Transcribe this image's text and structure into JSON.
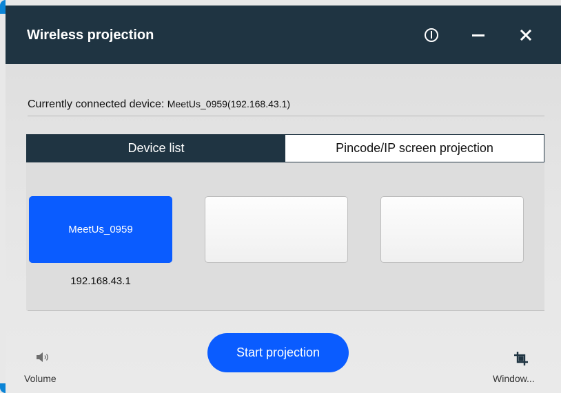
{
  "window": {
    "title": "Wireless projection",
    "accent_color": "#0a5cff",
    "titlebar_color": "#1f3442"
  },
  "titlebar_buttons": {
    "info_icon": "info-circle-icon",
    "minimize_icon": "minimize-icon",
    "close_icon": "close-icon"
  },
  "connection": {
    "label": "Currently connected device: ",
    "device": "MeetUs_0959(192.168.43.1)"
  },
  "tabs": [
    {
      "label": "Device list",
      "selected": true
    },
    {
      "label": "Pincode/IP screen projection",
      "selected": false
    }
  ],
  "devices": [
    {
      "name": "MeetUs_0959",
      "ip": "192.168.43.1",
      "selected": true
    },
    {
      "name": "",
      "ip": "",
      "selected": false
    },
    {
      "name": "",
      "ip": "",
      "selected": false
    }
  ],
  "actions": {
    "start_label": "Start projection",
    "volume_label": "Volume",
    "volume_icon": "speaker-icon",
    "window_label": "Window...",
    "window_icon": "crop-window-icon"
  }
}
